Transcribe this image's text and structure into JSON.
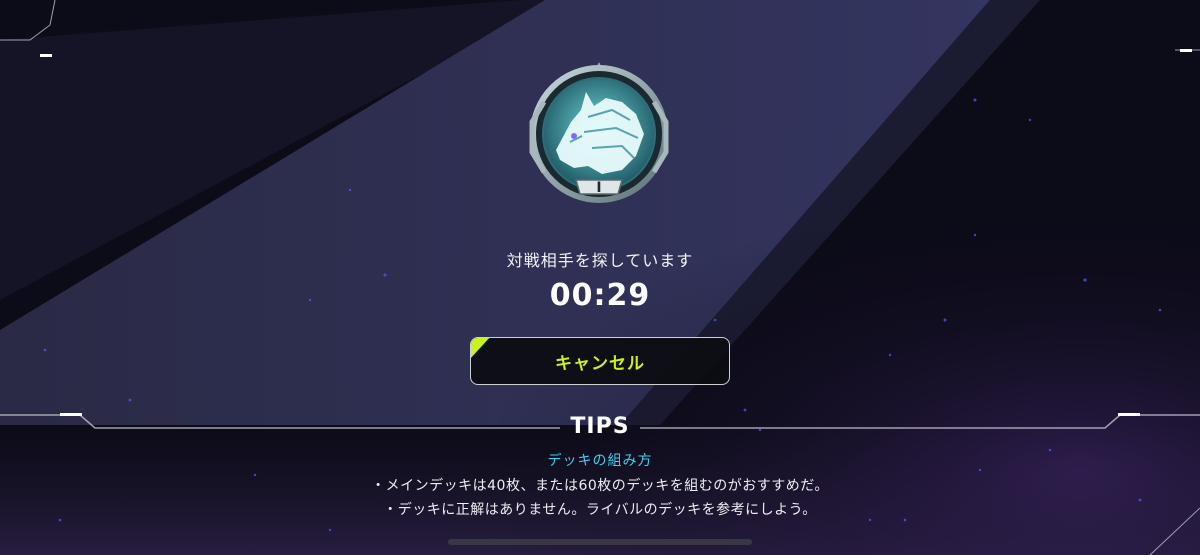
{
  "status": {
    "searching_text": "対戦相手を探しています",
    "timer": "00:29"
  },
  "cancel_button": {
    "label": "キャンセル",
    "accent_color": "#c8f31d"
  },
  "emblem": {
    "icon": "wolf-rank-emblem-icon",
    "rank_numeral": "I"
  },
  "tips": {
    "title": "TIPS",
    "subtitle": "デッキの組み方",
    "lines": [
      "・メインデッキは40枚、または60枚のデッキを組むのがおすすめだ。",
      "・デッキに正解はありません。ライバルのデッキを参考にしよう。"
    ]
  },
  "colors": {
    "accent": "#c8f31d",
    "tips_subtitle": "#3fd0f0",
    "background": "#0b0a16"
  }
}
